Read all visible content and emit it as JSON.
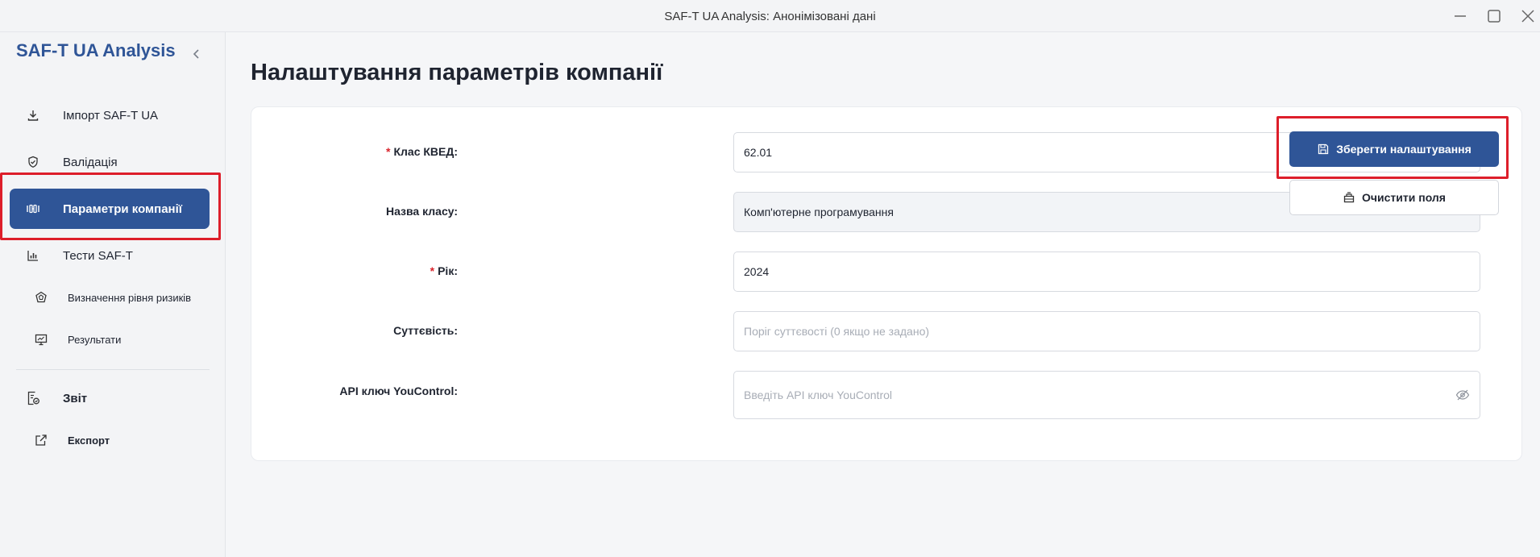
{
  "window": {
    "title": "SAF-T UA Analysis: Анонімізовані дані"
  },
  "sidebar": {
    "brand": "SAF-T UA Analysis",
    "items": [
      {
        "label": "Імпорт SAF-T UA",
        "icon": "download-icon"
      },
      {
        "label": "Валідація",
        "icon": "shield-check-icon"
      },
      {
        "label": "Параметри компанії",
        "icon": "sliders-icon",
        "active": true
      },
      {
        "label": "Тести SAF-T",
        "icon": "bar-chart-icon"
      },
      {
        "label": "Визначення рівня ризиків",
        "icon": "risk-icon"
      },
      {
        "label": "Результати",
        "icon": "presentation-icon"
      },
      {
        "label": "Звіт",
        "icon": "report-icon"
      },
      {
        "label": "Експорт",
        "icon": "export-icon"
      }
    ]
  },
  "main": {
    "title": "Налаштування параметрів компанії",
    "fields": [
      {
        "label": "Клас КВЕД:",
        "required": true,
        "value": "62.01",
        "placeholder": ""
      },
      {
        "label": "Назва класу:",
        "required": false,
        "value": "Комп'ютерне програмування",
        "placeholder": ""
      },
      {
        "label": "Рік:",
        "required": true,
        "value": "2024",
        "placeholder": ""
      },
      {
        "label": "Суттєвість:",
        "required": false,
        "value": "",
        "placeholder": "Поріг суттєвості (0 якщо не задано)"
      },
      {
        "label": "API ключ YouControl:",
        "required": false,
        "value": "",
        "placeholder": "Введіть API ключ YouControl"
      }
    ],
    "buttons": {
      "save": "Зберегти налаштування",
      "clear": "Очистити поля"
    }
  },
  "colors": {
    "accent": "#2f5597",
    "highlight": "#dd1e2a",
    "required": "#d9242c"
  }
}
